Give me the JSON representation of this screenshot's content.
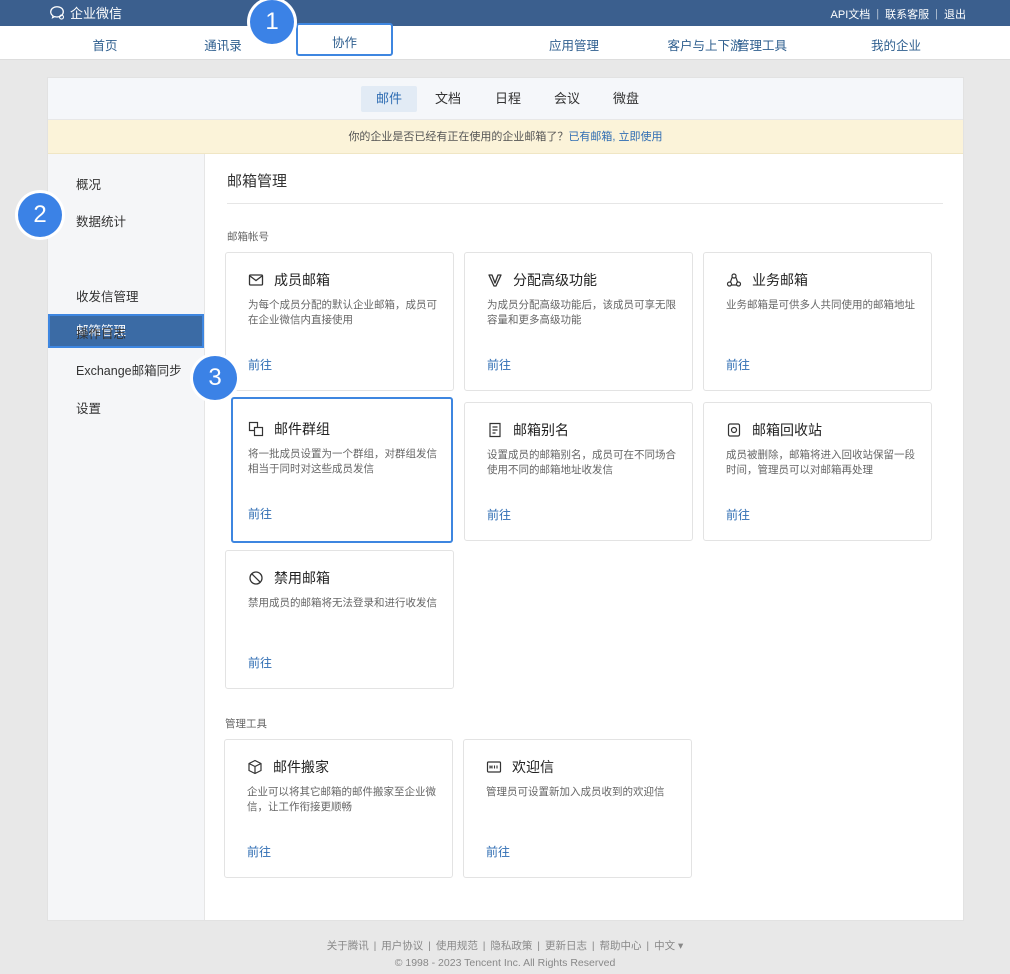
{
  "app": {
    "name": "企业微信"
  },
  "top_links": [
    "API文档",
    "联系客服",
    "退出"
  ],
  "main_nav": [
    "首页",
    "通讯录",
    "协作",
    "应用管理",
    "客户与上下游",
    "管理工具",
    "我的企业"
  ],
  "badges": [
    "1",
    "2",
    "3"
  ],
  "sub_tabs": [
    "邮件",
    "文档",
    "日程",
    "会议",
    "微盘"
  ],
  "notice": {
    "text": "你的企业是否已经有正在使用的企业邮箱了？",
    "link": "已有邮箱, 立即使用"
  },
  "sidebar": [
    "概况",
    "数据统计",
    "邮箱管理",
    "收发信管理",
    "操作日志",
    "Exchange邮箱同步",
    "设置"
  ],
  "content": {
    "title": "邮箱管理",
    "section1": "邮箱帐号",
    "section2": "管理工具",
    "go_label": "前往",
    "cards": [
      {
        "icon": "envelope-icon",
        "title": "成员邮箱",
        "desc": "为每个成员分配的默认企业邮箱，成员可在企业微信内直接使用"
      },
      {
        "icon": "v-badge-icon",
        "title": "分配高级功能",
        "desc": "为成员分配高级功能后，该成员可享无限容量和更多高级功能"
      },
      {
        "icon": "recycle-icon",
        "title": "业务邮箱",
        "desc": "业务邮箱是可供多人共同使用的邮箱地址"
      },
      {
        "icon": "group-icon",
        "title": "邮件群组",
        "desc": "将一批成员设置为一个群组，对群组发信相当于同时对这些成员发信"
      },
      {
        "icon": "alias-icon",
        "title": "邮箱别名",
        "desc": "设置成员的邮箱别名，成员可在不同场合使用不同的邮箱地址收发信"
      },
      {
        "icon": "trash-icon",
        "title": "邮箱回收站",
        "desc": "成员被删除，邮箱将进入回收站保留一段时间，管理员可以对邮箱再处理"
      },
      {
        "icon": "ban-icon",
        "title": "禁用邮箱",
        "desc": "禁用成员的邮箱将无法登录和进行收发信"
      }
    ],
    "tool_cards": [
      {
        "icon": "box-icon",
        "title": "邮件搬家",
        "desc": "企业可以将其它邮箱的邮件搬家至企业微信，让工作衔接更顺畅"
      },
      {
        "icon": "welcome-icon",
        "title": "欢迎信",
        "desc": "管理员可设置新加入成员收到的欢迎信"
      }
    ]
  },
  "footer": {
    "links": [
      "关于腾讯",
      "用户协议",
      "使用规范",
      "隐私政策",
      "更新日志",
      "帮助中心",
      "中文 ▾"
    ],
    "copyright": "© 1998 - 2023 Tencent Inc. All Rights Reserved"
  }
}
